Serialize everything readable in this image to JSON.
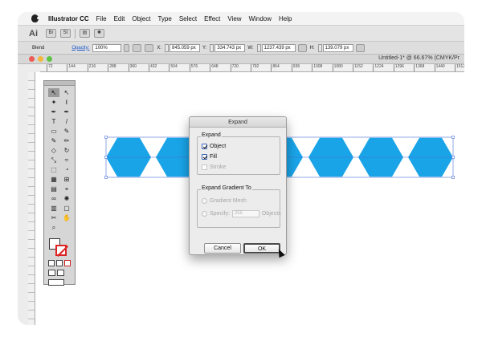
{
  "menubar": {
    "app": "Illustrator CC",
    "items": [
      "File",
      "Edit",
      "Object",
      "Type",
      "Select",
      "Effect",
      "View",
      "Window",
      "Help"
    ]
  },
  "appbar": {
    "logo": "Ai",
    "btn1": "Br",
    "btn2": "St"
  },
  "controlbar": {
    "mode": "Blend",
    "opacity_label": "Opacity:",
    "opacity_value": "100%",
    "x_label": "X:",
    "x_value": "845.059 px",
    "y_label": "Y:",
    "y_value": "334.743 px",
    "w_label": "W:",
    "w_value": "1237.439 px",
    "h_label": "H:",
    "h_value": "139.079 px"
  },
  "document": {
    "title": "Untitled-1* @ 66.67% (CMYK/Pr"
  },
  "ruler": {
    "ticks": [
      "72",
      "144",
      "216",
      "288",
      "360",
      "432",
      "504",
      "576",
      "648",
      "720",
      "792",
      "864",
      "936",
      "1008",
      "1080",
      "1152",
      "1224",
      "1296",
      "1368",
      "1440",
      "1512"
    ]
  },
  "colors": {
    "hex_fill": "#1aa4e8",
    "selection": "#4a6fd8",
    "stroke_none": "#dd2222"
  },
  "tools": {
    "icons": [
      "selection-tool",
      "direct-selection-tool",
      "magic-wand-tool",
      "lasso-tool",
      "pen-tool",
      "curvature-tool",
      "type-tool",
      "line-tool",
      "rectangle-tool",
      "paintbrush-tool",
      "shaper-tool",
      "pencil-tool",
      "eraser-tool",
      "rotate-tool",
      "scale-tool",
      "width-tool",
      "free-transform-tool",
      "shape-builder-tool",
      "perspective-tool",
      "mesh-tool",
      "gradient-tool",
      "eyedropper-tool",
      "blend-tool",
      "symbol-sprayer-tool",
      "column-graph-tool",
      "artboard-tool",
      "slice-tool",
      "hand-tool",
      "zoom-tool"
    ],
    "glyphs": [
      "↖",
      "↖",
      "✦",
      "ℓ",
      "✒",
      "✒",
      "T",
      "/",
      "▭",
      "✎",
      "✎",
      "✏",
      "◇",
      "↻",
      "⤡",
      "≈",
      "⬚",
      "◔",
      "▦",
      "⊞",
      "▤",
      "⌖",
      "∞",
      "✺",
      "▥",
      "▢",
      "✂",
      "✋",
      "⌕"
    ]
  },
  "dialog": {
    "title": "Expand",
    "expand_group": "Expand",
    "object_label": "Object",
    "object_checked": true,
    "fill_label": "Fill",
    "fill_checked": true,
    "stroke_label": "Stroke",
    "stroke_checked": false,
    "gradient_group": "Expand Gradient To",
    "gradient_mesh_label": "Gradient Mesh",
    "specify_label": "Specify:",
    "specify_value": "255",
    "objects_label": "Objects",
    "cancel_label": "Cancel",
    "ok_label": "OK"
  }
}
